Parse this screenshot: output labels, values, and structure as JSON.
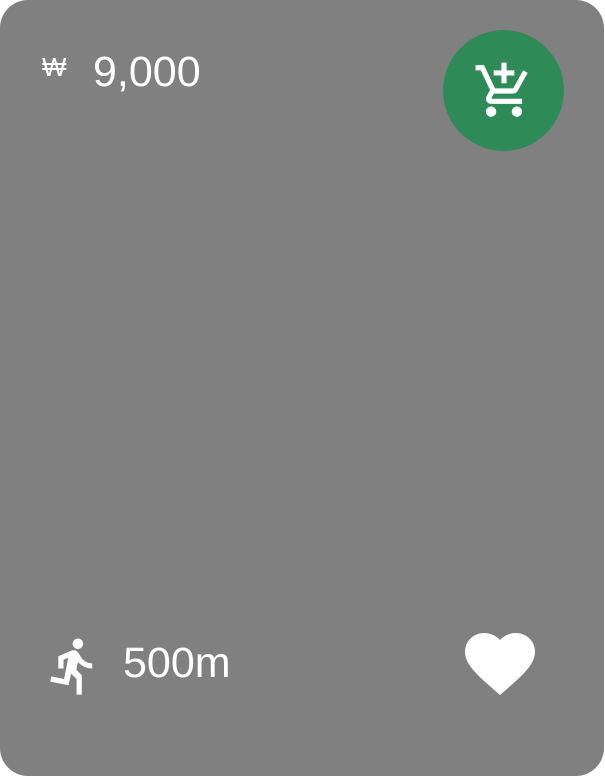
{
  "card": {
    "background_color": "#808080",
    "price": {
      "currency_symbol": "₩",
      "amount": "9,000"
    },
    "cart_button": {
      "icon": "add-to-cart-icon",
      "color": "#2e8b57"
    },
    "distance": {
      "icon": "walking-person-icon",
      "value": "500m"
    },
    "favorite_button": {
      "icon": "heart-icon",
      "color": "#ffffff"
    }
  }
}
